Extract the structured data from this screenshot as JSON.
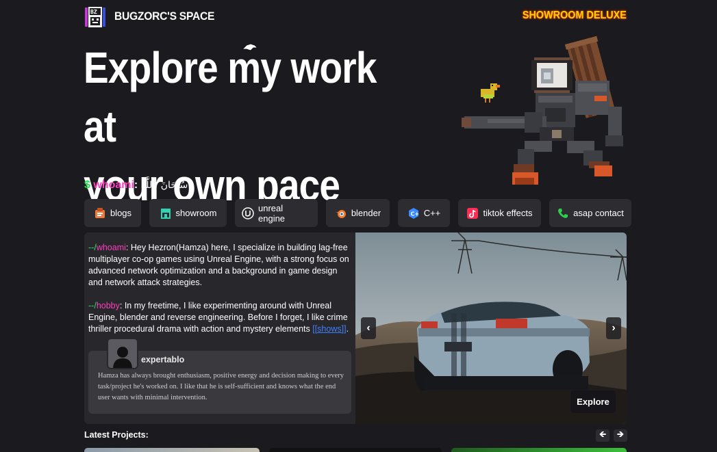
{
  "header": {
    "site_title": "BUGZORC'S SPACE",
    "badge": "SHOWROOM DELUXE"
  },
  "hero": {
    "line1": "Explore my work at",
    "line2": "your own pace"
  },
  "whoami": {
    "prompt": "$",
    "command": "whoami",
    "separator": ":",
    "value": "سُبْحَانَ ٱللَّٰهِ"
  },
  "nav": [
    {
      "label": "blogs",
      "icon": "blog-icon",
      "color": "#f07a3a"
    },
    {
      "label": "showroom",
      "icon": "storefront-icon",
      "color": "#2fd3b2"
    },
    {
      "label": "unreal engine",
      "icon": "unreal-engine-icon",
      "color": "#ffffff"
    },
    {
      "label": "blender",
      "icon": "blender-icon",
      "color": "#f5792a"
    },
    {
      "label": "C++",
      "icon": "cpp-icon",
      "color": "#3b8cff"
    },
    {
      "label": "tiktok effects",
      "icon": "tiktok-icon",
      "color": "#ff2d55"
    },
    {
      "label": "asap contact",
      "icon": "phone-icon",
      "color": "#2bd14a"
    }
  ],
  "bio": {
    "p1_prefix": "--/",
    "p1_tag": "whoami",
    "p1_text": ": Hey Hezron(Hamza) here, I specialize in building lag-free multiplayer co-op games using Unreal Engine, with a strong focus on advanced network optimization and a background in game design and network attack strategies.",
    "p2_prefix": "--/",
    "p2_tag": "hobby",
    "p2_text": ": In my freetime, I like experimenting around with Unreal Engine, blender and reverse engineering. Before I forget, I like crime thriller procedural drama with action and mystery elements ",
    "p2_link": "[[shows]]",
    "p2_end": "."
  },
  "testimonial": {
    "name": "expertablo",
    "text": "Hamza has always brought enthusiasm, positive energy and decision making to every task/project he's worked on. I like that he is self-sufficient and knows what the end user wants with minimal intervention."
  },
  "carousel": {
    "prev": "‹",
    "next": "›",
    "explore_label": "Explore"
  },
  "latest": {
    "title": "Latest Projects:",
    "prev": "🡸",
    "next": "🡺"
  },
  "colors": {
    "bg": "#1b1a1f",
    "card": "#2d2c31",
    "green": "#1ee04a",
    "pink": "#ff3ec0",
    "badge_yellow": "#ffd400",
    "link_blue": "#3f82ff"
  }
}
